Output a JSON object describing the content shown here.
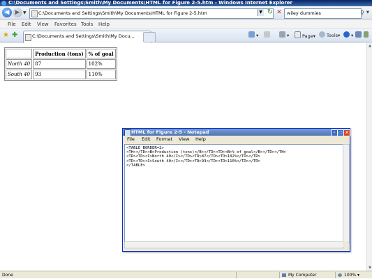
{
  "window": {
    "title": "C:\\Documents and Settings\\Smith\\My Documents\\HTML for Figure 2-5.htm - Windows Internet Explorer"
  },
  "address_bar": {
    "url": "C:\\Documents and Settings\\Smith\\My Documents\\HTML for Figure 2-5.htm",
    "search_value": "wiley dummies"
  },
  "menu": [
    "File",
    "Edit",
    "View",
    "Favorites",
    "Tools",
    "Help"
  ],
  "tab": {
    "label": "C:\\Documents and Settings\\Smith\\My Docu..."
  },
  "command_bar": {
    "page_label": "Page",
    "tools_label": "Tools"
  },
  "table": {
    "headers": [
      "",
      "Production (tons)",
      "% of goal"
    ],
    "rows": [
      [
        "North 40",
        "87",
        "102%"
      ],
      [
        "South 40",
        "93",
        "110%"
      ]
    ]
  },
  "notepad": {
    "title": "HTML for Figure 2-5 - Notepad",
    "menu": [
      "File",
      "Edit",
      "Format",
      "View",
      "Help"
    ],
    "lines": [
      "<TABLE BORDER=2>",
      "<TH></TD><B>Production (tons)</B></TD><TD><B>% of goal</B></TD></TH>",
      "<TR><TD><I>North 40</I></TD><TD>87</TD><TD>102%</TD></TR>",
      "<TR><TD><I>South 40</I></TD><TD>93</TD><TD>110%</TD></TR>",
      "</TABLE>"
    ]
  },
  "status_bar": {
    "left": "Done",
    "zone": "My Computer",
    "zoom": "100%"
  },
  "colors": {
    "title_bar": "#0a246a",
    "notepad_title": "#4e76b6",
    "stop": "#c0241c",
    "refresh": "#2a8a2a"
  }
}
